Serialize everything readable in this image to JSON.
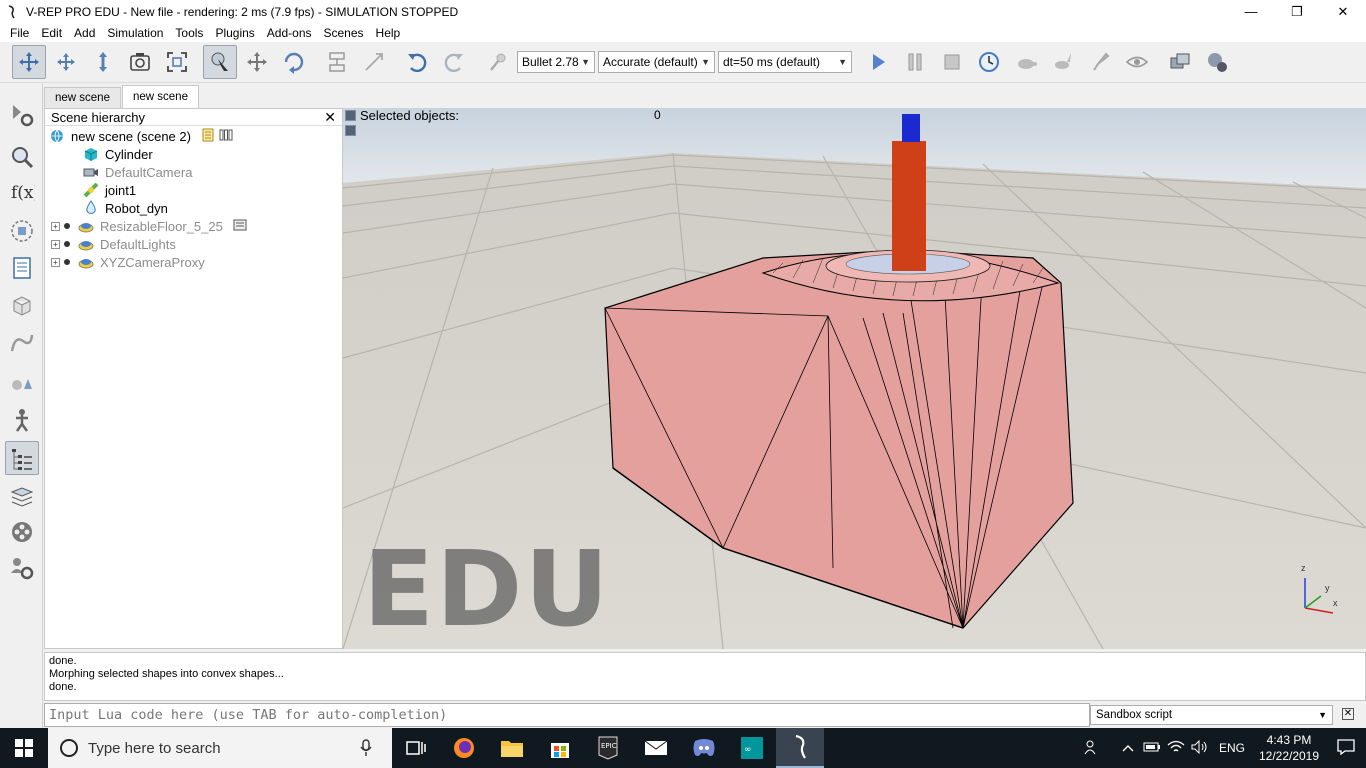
{
  "window": {
    "title": "V-REP PRO EDU - New file - rendering: 2 ms (7.9 fps) - SIMULATION STOPPED",
    "minimize": "—",
    "maximize": "❐",
    "close": "✕"
  },
  "menu": [
    "File",
    "Edit",
    "Add",
    "Simulation",
    "Tools",
    "Plugins",
    "Add-ons",
    "Scenes",
    "Help"
  ],
  "toolbar": {
    "engine": "Bullet 2.78",
    "accuracy": "Accurate (default)",
    "timestep": "dt=50 ms (default)"
  },
  "tabs": [
    "new scene",
    "new scene"
  ],
  "hierarchy": {
    "title": "Scene hierarchy",
    "close": "✕",
    "root": "new scene (scene 2)",
    "items": [
      {
        "label": "Cylinder",
        "dim": false,
        "icon": "shape-icon"
      },
      {
        "label": "DefaultCamera",
        "dim": true,
        "icon": "camera-icon"
      },
      {
        "label": "joint1",
        "dim": false,
        "icon": "joint-icon"
      },
      {
        "label": "Robot_dyn",
        "dim": false,
        "icon": "shape-icon"
      },
      {
        "label": "ResizableFloor_5_25",
        "dim": true,
        "icon": "model-icon"
      },
      {
        "label": "DefaultLights",
        "dim": true,
        "icon": "model-icon"
      },
      {
        "label": "XYZCameraProxy",
        "dim": true,
        "icon": "model-icon"
      }
    ],
    "expander": "+"
  },
  "viewport": {
    "selected_label": "Selected objects:",
    "selected_count": "0",
    "watermark": "EDU",
    "axis_z": "z",
    "axis_y": "y",
    "axis_x": "x"
  },
  "console": {
    "lines": [
      "done.",
      "Morphing selected shapes into convex shapes...",
      "done."
    ]
  },
  "lua": {
    "placeholder": "Input Lua code here (use TAB for auto-completion)",
    "script": "Sandbox script"
  },
  "taskbar": {
    "search_placeholder": "Type here to search",
    "lang": "ENG",
    "time": "4:43 PM",
    "date": "12/22/2019"
  },
  "colors": {
    "robot_body": "#e8a0a0",
    "rod": "#d04018",
    "cap": "#1a2ad0",
    "sky": "#cfd9e2"
  }
}
